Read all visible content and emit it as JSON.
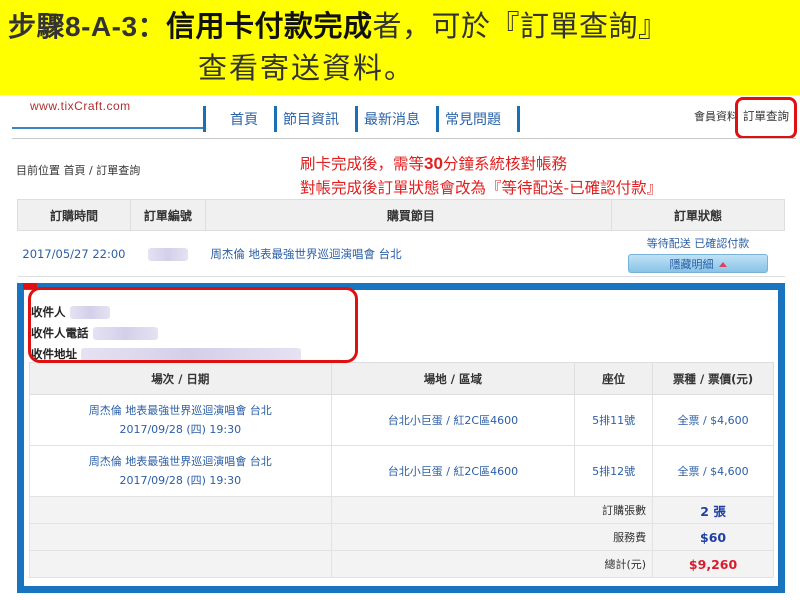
{
  "slide": {
    "step_code": "步驟8-A-3：",
    "line1_emph": "信用卡付款完成",
    "line1_rest": "者，可於『訂單查詢』",
    "line2": "查看寄送資料。"
  },
  "site": {
    "logo": "www.tixCraft.com",
    "nav": [
      "首頁",
      "節目資訊",
      "最新消息",
      "常見問題"
    ],
    "member_link": "會員資料",
    "order_query_link": "訂單查詢"
  },
  "breadcrumb": "目前位置 首頁 / 訂單查詢",
  "notice": {
    "line1_a": "刷卡完成後，需等",
    "line1_num": "30",
    "line1_b": "分鐘系統核對帳務",
    "line2": "對帳完成後訂單狀態會改為『等待配送-已確認付款』"
  },
  "orders_table": {
    "headers": [
      "訂購時間",
      "訂單編號",
      "購買節目",
      "訂單狀態"
    ],
    "row": {
      "time": "2017/05/27 22:00",
      "event": "周杰倫 地表最強世界巡迴演唱會 台北",
      "status": "等待配送 已確認付款",
      "toggle_label": "隱藏明細"
    }
  },
  "recipient": {
    "name_label": "收件人",
    "phone_label": "收件人電話",
    "address_label": "收件地址"
  },
  "seat_table": {
    "headers": [
      "場次 / 日期",
      "場地 / 區域",
      "座位",
      "票種 / 票價(元)"
    ],
    "rows": [
      {
        "event": "周杰倫 地表最強世界巡迴演唱會 台北",
        "date": "2017/09/28 (四) 19:30",
        "venue": "台北小巨蛋 / 紅2C區4600",
        "seat": "5排11號",
        "ticket": "全票 / $4,600"
      },
      {
        "event": "周杰倫 地表最強世界巡迴演唱會 台北",
        "date": "2017/09/28 (四) 19:30",
        "venue": "台北小巨蛋 / 紅2C區4600",
        "seat": "5排12號",
        "ticket": "全票 / $4,600"
      }
    ],
    "summary": {
      "count_label": "訂購張數",
      "count_value": "2 張",
      "fee_label": "服務費",
      "fee_value": "$60",
      "total_label": "總計(元)",
      "total_value": "$9,260"
    }
  },
  "colors": {
    "slide_bg": "#ffff00",
    "callout_red": "#e01010",
    "panel_blue": "#1874be",
    "link_blue": "#2b5ea6",
    "total_red": "#d81c2c"
  }
}
